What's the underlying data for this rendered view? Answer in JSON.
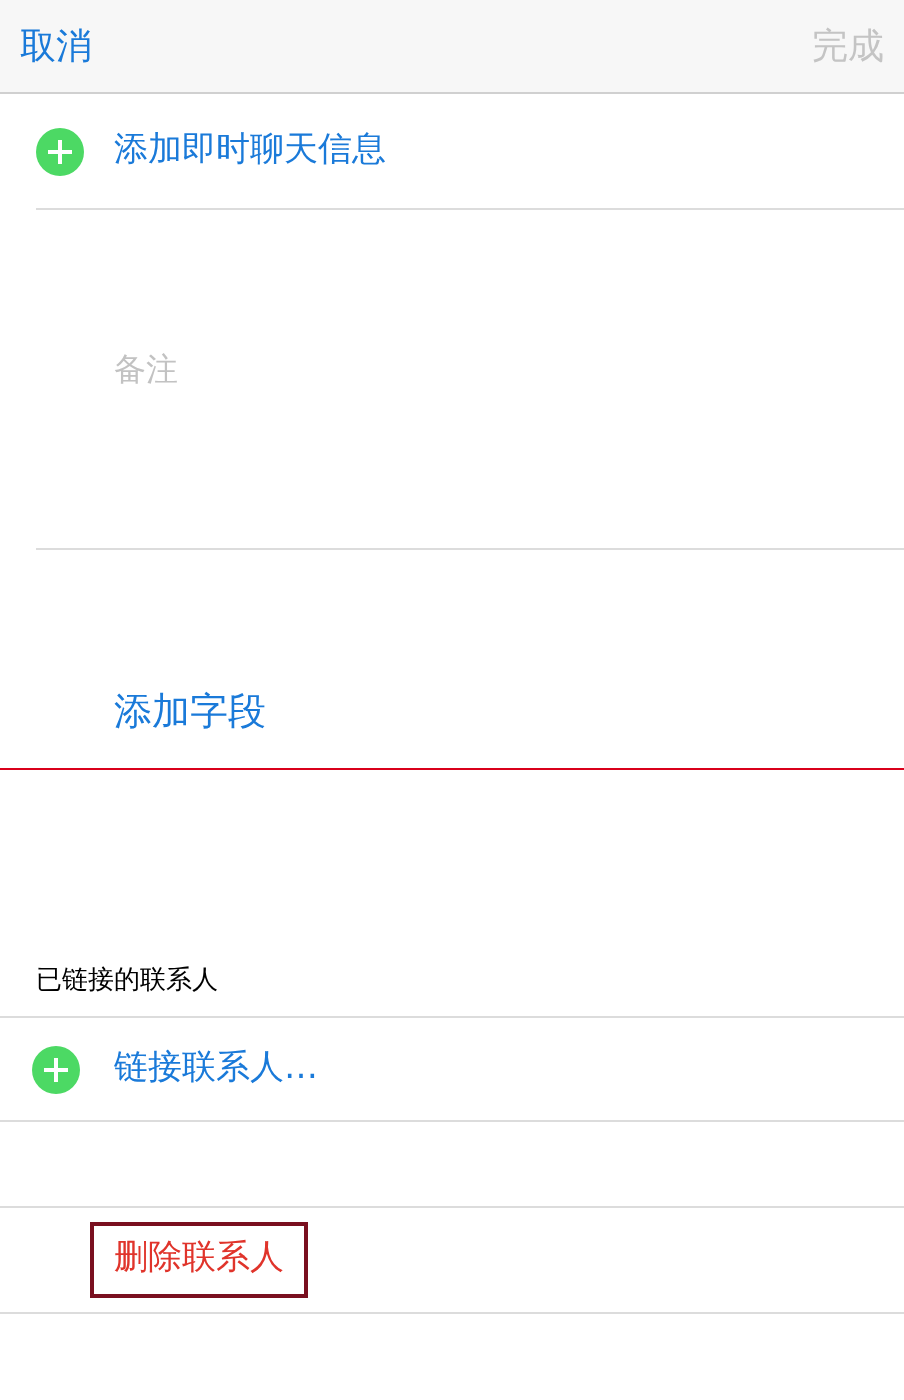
{
  "nav_bar": {
    "cancel": "取消",
    "done": {
      "label": "完成",
      "disabled": true
    }
  },
  "add_im_row": {
    "label": "添加即时聊天信息"
  },
  "notes": {
    "placeholder": "备注"
  },
  "add_field": {
    "label": "添加字段"
  },
  "linked_contacts": {
    "header": "已链接的联系人",
    "link_row": {
      "label": "链接联系人…"
    }
  },
  "delete_contact": {
    "label": "删除联系人",
    "highlighted": true
  }
}
